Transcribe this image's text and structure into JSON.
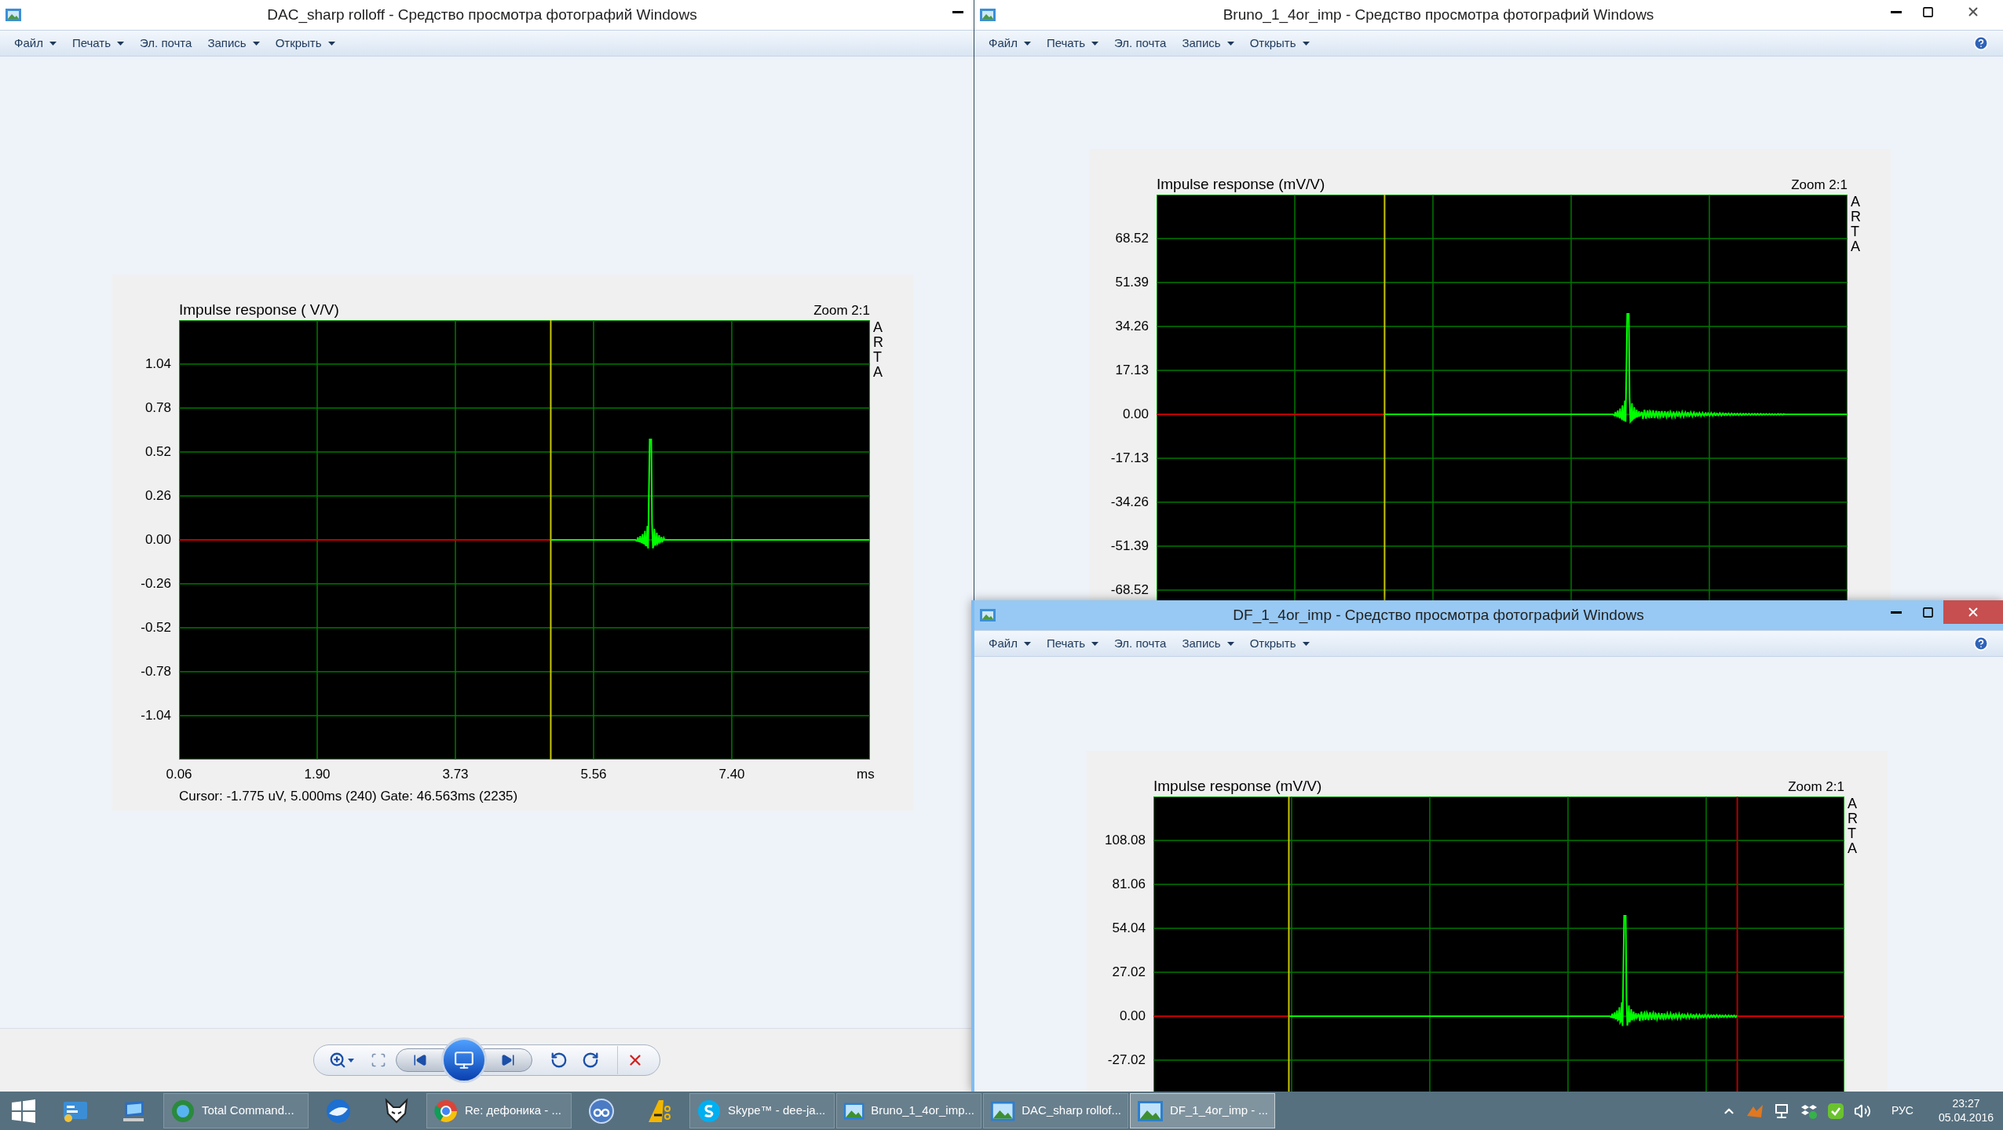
{
  "windows": [
    {
      "title": "DAC_sharp rolloff - Средство просмотра фотографий Windows",
      "active": false,
      "controls": [
        {
          "kind": "minimize"
        }
      ],
      "help": false,
      "menu": [
        {
          "label": "Файл",
          "dropdown": true
        },
        {
          "label": "Печать",
          "dropdown": true
        },
        {
          "label": "Эл. почта",
          "dropdown": false
        },
        {
          "label": "Запись",
          "dropdown": true
        },
        {
          "label": "Открыть",
          "dropdown": true
        }
      ],
      "chart": {
        "title": "Impulse response ( V/V)",
        "zoom": "Zoom 2:1",
        "brand": "ARTA",
        "y_ticks": [
          "1.04",
          "0.78",
          "0.52",
          "0.26",
          "0.00",
          "-0.26",
          "-0.52",
          "-0.78",
          "-1.04"
        ],
        "x_ticks": [
          "0.06",
          "1.90",
          "3.73",
          "5.56",
          "7.40"
        ],
        "x_unit": "ms",
        "status": "Cursor: -1.775 uV, 5.000ms (240)  Gate: 46.563ms (2235)"
      },
      "toolbar": [
        {
          "kind": "zoom"
        },
        {
          "kind": "fit"
        },
        {
          "kind": "previous"
        },
        {
          "kind": "slideshow"
        },
        {
          "kind": "next"
        },
        {
          "kind": "rotate-left"
        },
        {
          "kind": "rotate-right"
        },
        {
          "kind": "delete"
        }
      ]
    },
    {
      "title": "Bruno_1_4or_imp - Средство просмотра фотографий Windows",
      "active": false,
      "controls": [
        {
          "kind": "minimize"
        },
        {
          "kind": "maximize"
        },
        {
          "kind": "close"
        }
      ],
      "help": true,
      "menu": [
        {
          "label": "Файл",
          "dropdown": true
        },
        {
          "label": "Печать",
          "dropdown": true
        },
        {
          "label": "Эл. почта",
          "dropdown": false
        },
        {
          "label": "Запись",
          "dropdown": true
        },
        {
          "label": "Открыть",
          "dropdown": true
        }
      ],
      "chart": {
        "title": "Impulse response (mV/V)",
        "zoom": "Zoom 2:1",
        "brand": "ARTA",
        "y_ticks": [
          "68.52",
          "51.39",
          "34.26",
          "17.13",
          "0.00",
          "-17.13",
          "-34.26",
          "-51.39",
          "-68.52"
        ]
      }
    },
    {
      "title": "DF_1_4or_imp - Средство просмотра фотографий Windows",
      "active": true,
      "controls": [
        {
          "kind": "minimize"
        },
        {
          "kind": "maximize"
        },
        {
          "kind": "close"
        }
      ],
      "help": true,
      "menu": [
        {
          "label": "Файл",
          "dropdown": true
        },
        {
          "label": "Печать",
          "dropdown": true
        },
        {
          "label": "Эл. почта",
          "dropdown": false
        },
        {
          "label": "Запись",
          "dropdown": true
        },
        {
          "label": "Открыть",
          "dropdown": true
        }
      ],
      "chart": {
        "title": "Impulse response (mV/V)",
        "zoom": "Zoom 2:1",
        "brand": "ARTA",
        "y_ticks": [
          "108.08",
          "81.06",
          "54.04",
          "27.02",
          "0.00",
          "-27.02"
        ]
      }
    }
  ],
  "taskbar": {
    "items": [
      {
        "kind": "start"
      },
      {
        "kind": "pinned"
      },
      {
        "kind": "pinned"
      },
      {
        "kind": "window",
        "label": "Total Command...",
        "selected": false
      },
      {
        "kind": "pinned"
      },
      {
        "kind": "pinned"
      },
      {
        "kind": "window",
        "label": "Re: дефоника - ...",
        "selected": false
      },
      {
        "kind": "pinned"
      },
      {
        "kind": "pinned"
      },
      {
        "kind": "window",
        "label": "Skype™ - dee-ja...",
        "selected": false
      },
      {
        "kind": "window",
        "label": "Bruno_1_4or_imp...",
        "selected": false
      },
      {
        "kind": "window",
        "label": "DAC_sharp rollof...",
        "selected": false
      },
      {
        "kind": "window",
        "label": "DF_1_4or_imp - ...",
        "selected": true
      }
    ],
    "language": "РУС",
    "time": "23:27",
    "date": "05.04.2016"
  }
}
